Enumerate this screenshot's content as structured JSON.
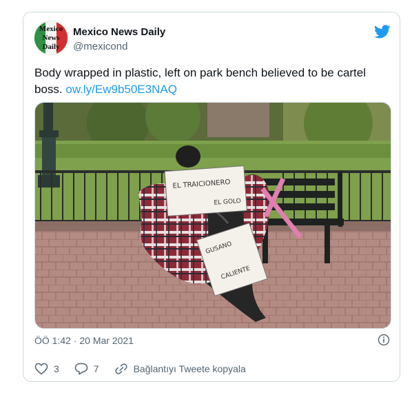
{
  "account": {
    "display_name": "Mexico News Daily",
    "handle": "@mexicond",
    "avatar_text": [
      "Mexico",
      "News",
      "Daily"
    ]
  },
  "tweet": {
    "text": "Body wrapped in plastic, left on park bench believed to be cartel boss. ",
    "link": "ow.ly/Ew9b50E3NAQ",
    "timestamp": "ÖÖ 1:42 · 20 Mar 2021"
  },
  "image": {
    "sign_top": [
      "EL TRAICIONERO",
      "EL GOLO"
    ],
    "sign_bottom": [
      "GUSANO",
      "CALIENTE"
    ]
  },
  "actions": {
    "like_count": "3",
    "reply_count": "7",
    "copy_link_label": "Bağlantıyı Tweete kopyala"
  },
  "colors": {
    "accent": "#1d9bf0",
    "text": "#0f1419",
    "muted": "#536471"
  },
  "icons": [
    "twitter-bird-icon",
    "info-icon",
    "heart-icon",
    "reply-icon",
    "link-icon"
  ]
}
